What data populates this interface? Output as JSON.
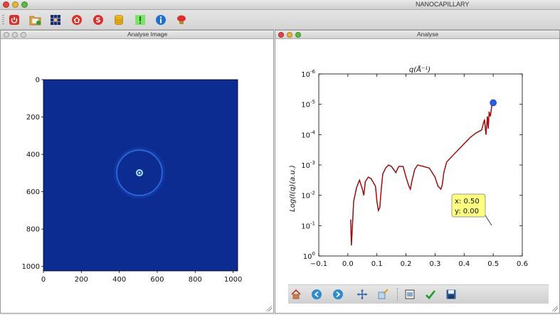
{
  "app": {
    "title": "NANOCAPILLARY"
  },
  "toolbar": {
    "buttons": [
      {
        "name": "quit-button",
        "icon": "power-icon"
      },
      {
        "name": "open-folder-button",
        "icon": "folder-open-icon"
      },
      {
        "name": "grid-view-button",
        "icon": "grid-icon"
      },
      {
        "name": "home-button",
        "icon": "home-icon"
      },
      {
        "name": "save-button",
        "icon": "s-circle-icon"
      },
      {
        "name": "database-button",
        "icon": "database-icon"
      },
      {
        "name": "alert-button",
        "icon": "exclamation-icon"
      },
      {
        "name": "info-button",
        "icon": "info-icon"
      },
      {
        "name": "stop-button",
        "icon": "stop-icon"
      }
    ]
  },
  "image_window": {
    "title": "Analyse Image",
    "x_ticks": [
      "0",
      "200",
      "400",
      "600",
      "800",
      "1000"
    ],
    "y_ticks": [
      "0",
      "200",
      "400",
      "600",
      "800",
      "1000"
    ]
  },
  "plot_window": {
    "title": "Analyse",
    "plot_title": "q(Å⁻¹)",
    "ylabel": "Log(I(q)(a.u.)",
    "annotation": {
      "x_text": "x: 0.50",
      "y_text": "y: 0.00"
    }
  },
  "chart_data": {
    "type": "line",
    "title": "q(Å⁻¹)",
    "xlabel": "",
    "ylabel": "Log(I(q)(a.u.)",
    "xlim": [
      -0.1,
      0.6
    ],
    "y_scale": "log",
    "ylim_exponent": [
      -6,
      0
    ],
    "x_ticks": [
      -0.1,
      0.0,
      0.1,
      0.2,
      0.3,
      0.4,
      0.5,
      0.6
    ],
    "x_tick_labels": [
      "−0.1",
      "0.0",
      "0.1",
      "0.2",
      "0.3",
      "0.4",
      "0.5",
      "0.6"
    ],
    "y_tick_labels": [
      {
        "base": "10",
        "exp": "0",
        "v": 0
      },
      {
        "base": "10",
        "exp": "-1",
        "v": -1
      },
      {
        "base": "10",
        "exp": "-2",
        "v": -2
      },
      {
        "base": "10",
        "exp": "-3",
        "v": -3
      },
      {
        "base": "10",
        "exp": "-4",
        "v": -4
      },
      {
        "base": "10",
        "exp": "-5",
        "v": -5
      },
      {
        "base": "10",
        "exp": "-6",
        "v": -6
      }
    ],
    "series": [
      {
        "color": "#cc0000",
        "x": [
          0.01,
          0.012,
          0.015,
          0.02,
          0.03,
          0.04,
          0.05,
          0.055,
          0.06,
          0.07,
          0.08,
          0.095,
          0.1,
          0.105,
          0.11,
          0.115,
          0.12,
          0.13,
          0.14,
          0.15,
          0.165,
          0.175,
          0.19,
          0.2,
          0.21,
          0.215,
          0.22,
          0.23,
          0.24,
          0.26,
          0.28,
          0.3,
          0.31,
          0.32,
          0.325,
          0.33,
          0.34,
          0.36,
          0.38,
          0.4,
          0.42,
          0.44,
          0.46,
          0.47,
          0.475,
          0.48,
          0.483,
          0.486,
          0.49,
          0.495,
          0.5
        ],
        "log_y": [
          -1.2,
          -0.35,
          -0.85,
          -1.8,
          -2.25,
          -2.5,
          -2.2,
          -2.0,
          -2.45,
          -2.6,
          -2.55,
          -2.3,
          -1.8,
          -1.5,
          -1.6,
          -2.2,
          -2.7,
          -2.9,
          -3.0,
          -2.95,
          -2.75,
          -2.95,
          -2.95,
          -2.6,
          -2.3,
          -2.2,
          -2.45,
          -2.85,
          -3.0,
          -2.95,
          -2.9,
          -2.6,
          -2.3,
          -2.2,
          -2.35,
          -2.75,
          -3.1,
          -3.3,
          -3.5,
          -3.7,
          -3.9,
          -4.05,
          -4.15,
          -4.5,
          -4.0,
          -4.6,
          -4.2,
          -4.75,
          -4.6,
          -4.95,
          -5.05
        ]
      }
    ],
    "marker": {
      "x": 0.5,
      "log_y": -5.05
    }
  }
}
